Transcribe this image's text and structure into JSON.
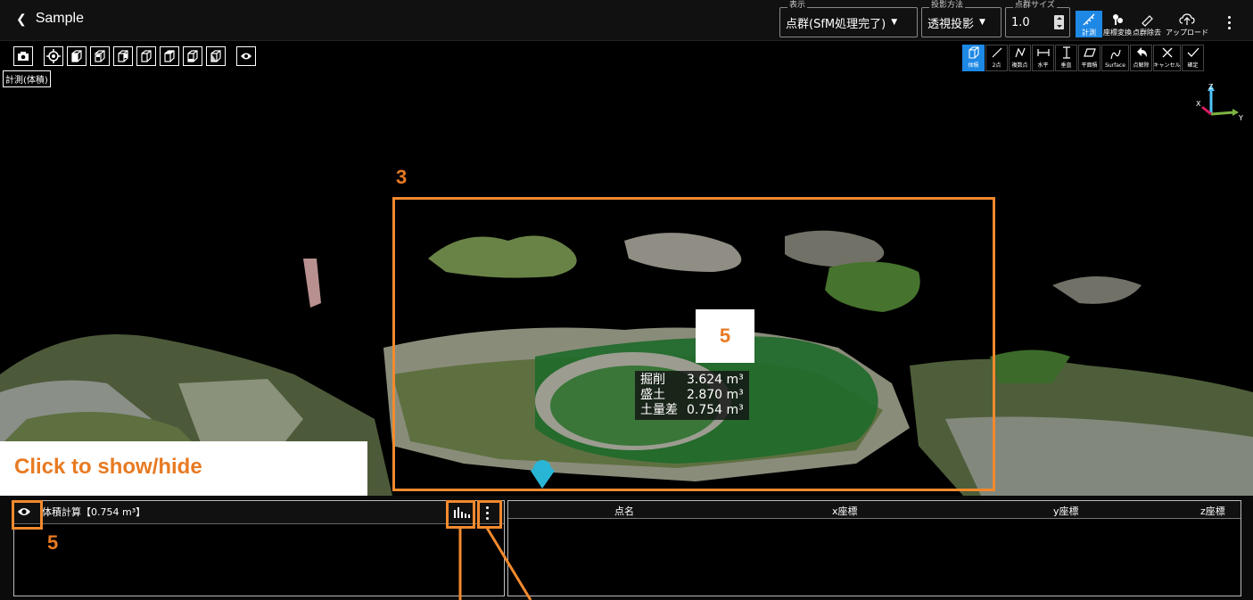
{
  "header": {
    "back_label": "Sample",
    "display": {
      "legend": "表示",
      "value": "点群(SfM処理完了)"
    },
    "projection": {
      "legend": "投影方法",
      "value": "透視投影"
    },
    "point_size": {
      "legend": "点群サイズ",
      "value": "1.0"
    },
    "buttons": {
      "measure": "計測",
      "coord_transform": "座標変換",
      "point_remove": "点群除去",
      "upload": "アップロード"
    }
  },
  "mode_label": "計測(体積)",
  "measure_tools": [
    "体積",
    "2点",
    "複数点",
    "水平",
    "垂直",
    "平面積",
    "Surface",
    "点解除",
    "キャンセル",
    "確定"
  ],
  "axes": {
    "z": "Z",
    "x": "X",
    "y": "Y"
  },
  "result": {
    "rows": [
      {
        "label": "掘削",
        "value": "3.624 m³"
      },
      {
        "label": "盛土",
        "value": "2.870 m³"
      },
      {
        "label": "土量差",
        "value": "0.754 m³"
      }
    ]
  },
  "annotations": {
    "n3": "3",
    "n5_scene": "5",
    "n5_panel": "5",
    "hint": "Click to show/hide"
  },
  "volume_panel": {
    "title": "体積計算【0.754 m³】"
  },
  "points_table": {
    "columns": [
      "点名",
      "x座標",
      "y座標",
      "z座標"
    ]
  },
  "colors": {
    "accent": "#1e88e5",
    "annotation": "#f28a2e",
    "volume_fill": "#2e7d32"
  }
}
